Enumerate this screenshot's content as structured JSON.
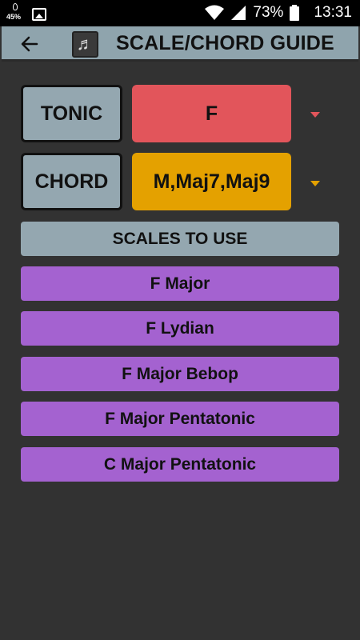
{
  "status_bar": {
    "battery_small_pct": "45%",
    "battery_pct": "73%",
    "time": "13:31",
    "icons": [
      "battery-saver-icon",
      "image-icon",
      "wifi-icon",
      "signal-icon",
      "battery-icon"
    ]
  },
  "app_bar": {
    "title": "SCALE/CHORD GUIDE",
    "logo_icon": "music-note-icon",
    "back_icon": "back-arrow-icon"
  },
  "tonic": {
    "label": "TONIC",
    "value": "F",
    "color": "#e2555b"
  },
  "chord": {
    "label": "CHORD",
    "value": "M,Maj7,Maj9",
    "color": "#e4a100"
  },
  "scales": {
    "header": "SCALES TO USE",
    "items": [
      "F Major",
      "F Lydian",
      "F Major Bebop",
      "F Major Pentatonic",
      "C Major Pentatonic"
    ],
    "item_color": "#a462d0"
  },
  "colors": {
    "background": "#323232",
    "label_button": "#94a7b0",
    "tonic_caret": "#e2555b",
    "chord_caret": "#e4a100"
  }
}
